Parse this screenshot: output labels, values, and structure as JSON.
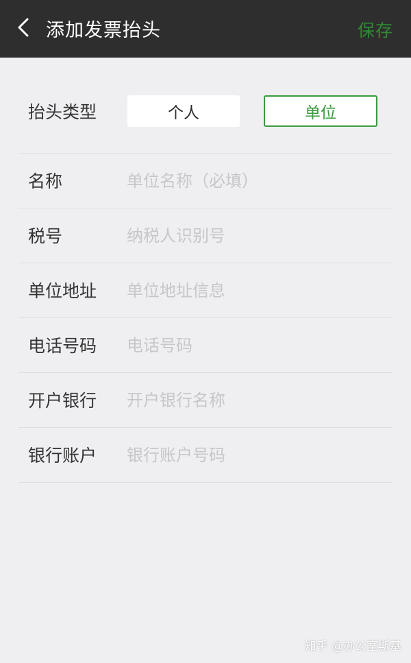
{
  "header": {
    "back_icon": "chevron-left-icon",
    "title": "添加发票抬头",
    "save_label": "保存"
  },
  "invoice_type": {
    "label": "抬头类型",
    "options": [
      "个人",
      "单位"
    ],
    "selected": "单位"
  },
  "fields": [
    {
      "label": "名称",
      "value": "",
      "placeholder": "单位名称（必填）"
    },
    {
      "label": "税号",
      "value": "",
      "placeholder": "纳税人识别号"
    },
    {
      "label": "单位地址",
      "value": "",
      "placeholder": "单位地址信息"
    },
    {
      "label": "电话号码",
      "value": "",
      "placeholder": "电话号码"
    },
    {
      "label": "开户银行",
      "value": "",
      "placeholder": "开户银行名称"
    },
    {
      "label": "银行账户",
      "value": "",
      "placeholder": "银行账户号码"
    }
  ],
  "colors": {
    "header_bg": "#2e2e2e",
    "accent": "#3a9a3c",
    "save": "#2f8a32",
    "page_bg": "#efeff2",
    "placeholder": "#c7c7c9"
  },
  "watermark": "知乎 @办公室斯基"
}
